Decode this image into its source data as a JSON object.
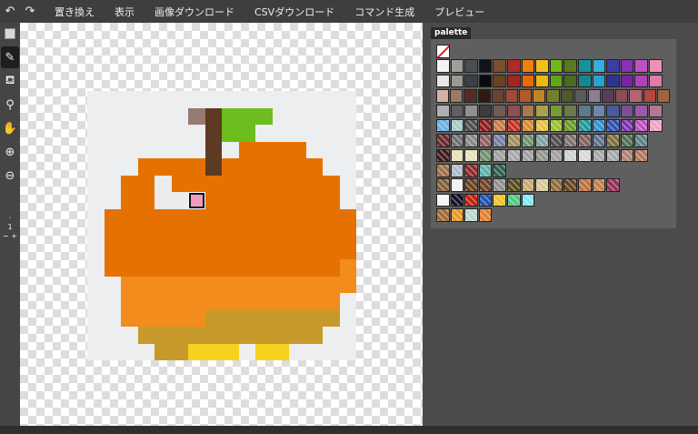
{
  "menu": {
    "undo_icon": "undo-icon",
    "redo_icon": "redo-icon",
    "items": [
      "置き換え",
      "表示",
      "画像ダウンロード",
      "CSVダウンロード",
      "コマンド生成",
      "プレビュー"
    ]
  },
  "tools": {
    "icons": [
      "select-rect-icon",
      "pencil-icon",
      "fill-bucket-icon",
      "eyedropper-icon",
      "hand-icon",
      "zoom-in-icon",
      "zoom-out-icon"
    ],
    "active": "pencil-icon",
    "zoom_value": "1",
    "zoom_minus": "−",
    "zoom_plus": "+"
  },
  "palette_title": "palette",
  "art": {
    "legend": {
      "W": "#eceeef",
      "B": "#977a70",
      "D": "#5e3a22",
      "G": "#6dbd1e",
      "O": "#e57200",
      "o": "#f28c1c",
      "Y": "#c69a2a",
      "y": "#f6d11e",
      "w": "#ececea",
      "P": "#f09ac0"
    },
    "rows": [
      "WWWWWWWWWWWWWWWW",
      "WWWWWWBDGGGWWWWW",
      "WWWWWWWDGGWWWWWW",
      "WWWWWWWDWOOOOWWW",
      "WWWOOOODOOOOOOWW",
      "WWOOwOOOOOOOOOOW",
      "WWOOwwPOOOOOOOOW",
      "WOOOOOOOOOOOOOOO",
      "WOOOOOOOOOOOOOOO",
      "WOOOOOOOOOOOOOOO",
      "WOOOOOOOOOOOOOOo",
      "WWoooooooooooooo",
      "WWoooooooooooooW",
      "WWoooooYYYYYYYYW",
      "WWWYYYYYYYYYYYWW",
      "WWWWYYyyyWyyWWWW"
    ],
    "selected": [
      6,
      6
    ]
  },
  "palette": [
    [
      "#f4f4f4",
      "#a0a09a",
      "#4a4e52",
      "#101318",
      "#7b4f2c",
      "#b02a26",
      "#f07d10",
      "#f2c21a",
      "#70b81c",
      "#5a7a22",
      "#17919a",
      "#3aaedb",
      "#3a3fa4",
      "#8a2fb8",
      "#c050c8",
      "#ee90b8"
    ],
    [
      "#e6e8e8",
      "#9a9a92",
      "#3c4044",
      "#080a0c",
      "#6a4224",
      "#a42420",
      "#e86c00",
      "#eeb810",
      "#5ea818",
      "#4a6a20",
      "#15888f",
      "#2aa0d2",
      "#2e3394",
      "#7a22a8",
      "#b042b8",
      "#e07aa6"
    ],
    [
      "#d6b2a2",
      "#9e7868",
      "#502e24",
      "#2e1a12",
      "#6a4430",
      "#a04a38",
      "#b05c24",
      "#c08424",
      "#72802e",
      "#4e5a28",
      "#5a5a5a",
      "#8a7e92",
      "#5a3e5c",
      "#8a4e58",
      "#b46474",
      "#b04840",
      "#a06438"
    ],
    [
      "#b0b0b0",
      "#606060",
      "#909090",
      "#3c3c3c",
      "#6e5e52",
      "#904e52",
      "#a8784e",
      "#a8a04c",
      "#7a9a36",
      "#6a7a48",
      "#5e7a88",
      "#6c86b0",
      "#4c5a98",
      "#7a5096",
      "#9a5aa8",
      "#b07a96"
    ],
    [
      "#6ab0e0",
      "#a8c8c8",
      "#505050",
      "#8a1e1e",
      "#c87a4a",
      "#c83020",
      "#d88a30",
      "#e8c040",
      "#98c028",
      "#6a9a28",
      "#20989e",
      "#3090d0",
      "#3050b0",
      "#8030b0",
      "#c050c0",
      "#f0a0c8"
    ],
    [
      "#6a2a2a",
      "#707070",
      "#888888",
      "#906060",
      "#7080a0",
      "#a09060",
      "#709070",
      "#80a0a0",
      "#505050",
      "#807070",
      "#806060",
      "#607090",
      "#807040",
      "#507050",
      "#608080"
    ],
    [
      "#401a1a",
      "#e8e0b8",
      "#e8e0b8",
      "#709070",
      "#a0a0a0",
      "#a8a8a8",
      "#a0a0a0",
      "#909888",
      "#a0a0a0",
      "#d0d0d0",
      "#d8d8d8",
      "#a8a8a8",
      "#a8a8a8",
      "#b08070",
      "#b07860"
    ],
    [
      "#a0704a",
      "#b0b8c8",
      "#902828",
      "#60b0a8",
      "#306050"
    ],
    [
      "#80603a",
      "#f0f0f0",
      "#6a4020",
      "#6a4426",
      "#909090",
      "#5a4a1e",
      "#c8a870",
      "#d8c898",
      "#906a3a",
      "#6a4420",
      "#c07040",
      "#c08050",
      "#903058"
    ],
    [
      "#f4f4f4",
      "#101028",
      "#c02010",
      "#2050b0",
      "#f0c020",
      "#50c880",
      "#80e8f0"
    ],
    [
      "#a06a30",
      "#e89820",
      "#b8d8d0",
      "#e08030"
    ]
  ]
}
